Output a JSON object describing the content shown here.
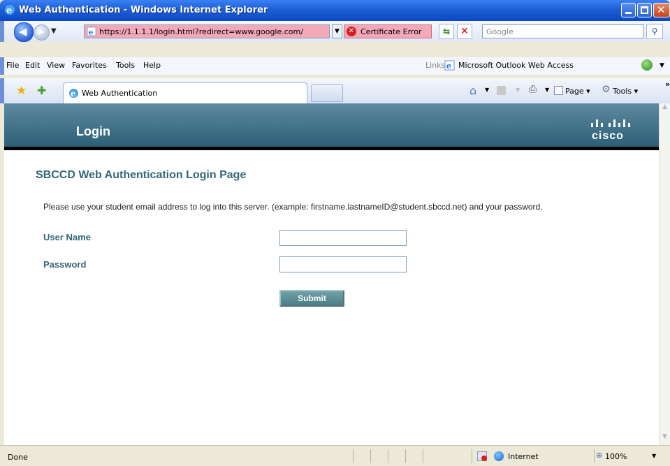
{
  "window": {
    "title": "Web Authentication - Windows Internet Explorer"
  },
  "address_bar": {
    "url": "https://1.1.1.1/login.html?redirect=www.google.com/",
    "certificate_error": "Certificate Error",
    "search_placeholder": "Google"
  },
  "menu": {
    "items": [
      "File",
      "Edit",
      "View",
      "Favorites",
      "Tools",
      "Help"
    ],
    "links_label": "Links",
    "links_item": "Microsoft Outlook Web Access"
  },
  "tabs": [
    {
      "label": "Web Authentication"
    }
  ],
  "command_bar": {
    "page_label": "Page ▾",
    "tools_label": "Tools ▾"
  },
  "page": {
    "banner_title": "Login",
    "logo_text": "cisco",
    "heading": "SBCCD Web Authentication Login Page",
    "instructions": "Please use your student email address to log into this server. (example: firstname.lastnameID@student.sbccd.net) and your password.",
    "username_label": "User Name",
    "password_label": "Password",
    "username_value": "",
    "password_value": "",
    "submit_label": "Submit"
  },
  "status_bar": {
    "status": "Done",
    "zone": "Internet",
    "zoom": "100%"
  },
  "colors": {
    "banner": "#3f6f86",
    "label": "#336677",
    "url_error_bg": "#f5a8b8",
    "submit": "#5b8f96"
  }
}
